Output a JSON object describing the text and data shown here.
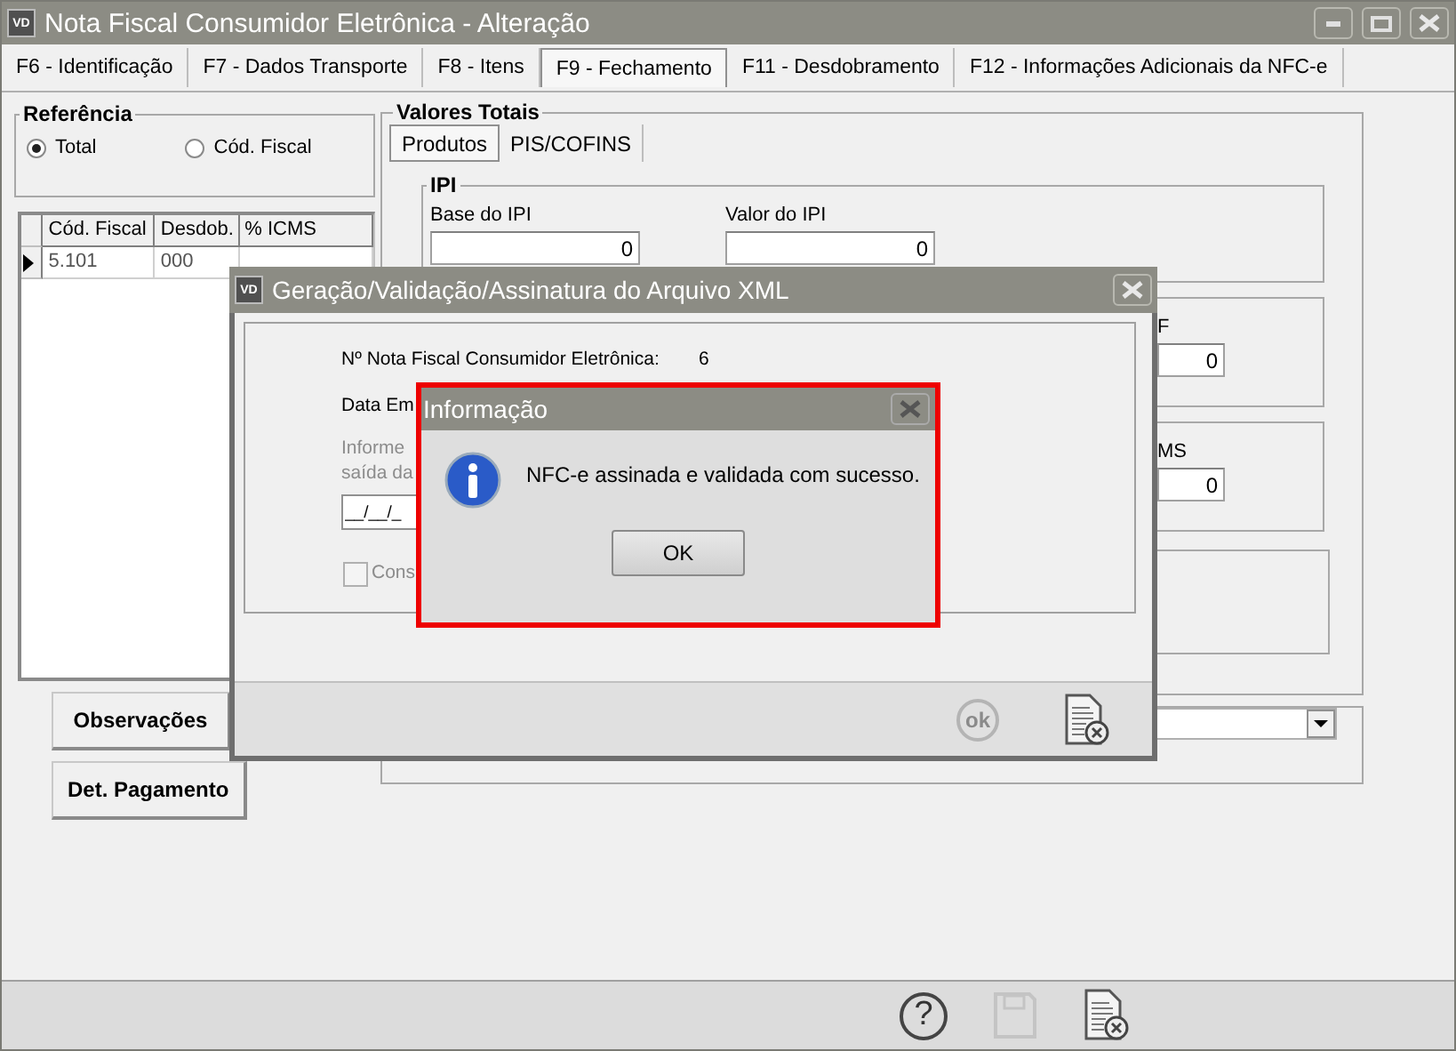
{
  "window": {
    "icon": "VD",
    "title": "Nota Fiscal Consumidor Eletrônica - Alteração"
  },
  "tabs": [
    {
      "label": "F6 - Identificação",
      "selected": false
    },
    {
      "label": "F7 - Dados Transporte",
      "selected": false
    },
    {
      "label": "F8 - Itens",
      "selected": false
    },
    {
      "label": "F9 - Fechamento",
      "selected": true
    },
    {
      "label": "F11 - Desdobramento",
      "selected": false
    },
    {
      "label": "F12 - Informações Adicionais da NFC-e",
      "selected": false
    }
  ],
  "referencia": {
    "title": "Referência",
    "options": [
      {
        "label": "Total",
        "selected": true
      },
      {
        "label": "Cód. Fiscal",
        "selected": false
      }
    ]
  },
  "grid": {
    "columns": [
      "Cód. Fiscal",
      "Desdob.",
      "% ICMS"
    ],
    "rows": [
      {
        "selected": true,
        "cells": [
          "5.101",
          "000"
        ]
      }
    ]
  },
  "side_buttons": [
    "Observações",
    "Det. Pagamento"
  ],
  "valores_totais": {
    "title": "Valores Totais",
    "tabs": [
      {
        "label": "Produtos",
        "selected": true
      },
      {
        "label": "PIS/COFINS",
        "selected": false
      }
    ],
    "ipi": {
      "title": "IPI",
      "fields": [
        {
          "label": "Base do IPI",
          "value": "0"
        },
        {
          "label": "Valor do IPI",
          "value": "0"
        }
      ]
    },
    "field_3": {
      "label": "F",
      "value": "0"
    },
    "field_4": {
      "label": "MS",
      "value": "0"
    }
  },
  "toolbar": [
    {
      "kind": "help",
      "label": "?",
      "disabled": false
    },
    {
      "kind": "save",
      "disabled": true
    },
    {
      "kind": "close",
      "disabled": false
    }
  ],
  "xml_dialog": {
    "icon": "VD",
    "title": "Geração/Validação/Assinatura do Arquivo XML",
    "nota_label": "Nº Nota Fiscal Consumidor Eletrônica:",
    "nota_value": "6",
    "data_label": "Data Em",
    "hint_lines": [
      "Informe",
      "saída da"
    ],
    "date_value": "__/__/_",
    "checkbox": {
      "label": "Cons",
      "checked": false,
      "disabled": true
    },
    "footer_buttons": [
      {
        "kind": "ok",
        "label": "ok",
        "disabled": true
      },
      {
        "kind": "close",
        "disabled": false
      }
    ]
  },
  "info_dialog": {
    "title": "Informação",
    "message": "NFC-e assinada e validada com sucesso.",
    "button": "OK",
    "highlighted": true
  }
}
